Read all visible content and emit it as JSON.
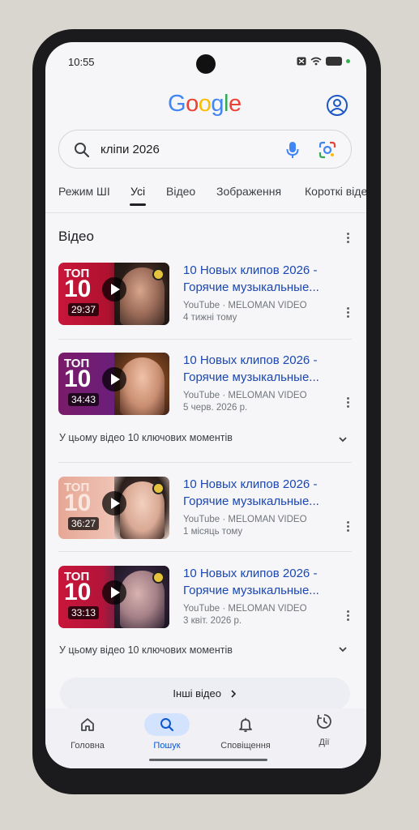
{
  "status": {
    "time": "10:55"
  },
  "header": {
    "logo": "Google",
    "account_icon": "account-circle-icon"
  },
  "search": {
    "query": "кліпи 2026"
  },
  "tabs": [
    {
      "label": "Режим ШІ"
    },
    {
      "label": "Усі",
      "active": true
    },
    {
      "label": "Відео"
    },
    {
      "label": "Зображення"
    },
    {
      "label": "Короткі відео"
    }
  ],
  "section": {
    "title": "Відео"
  },
  "videos": [
    {
      "title_line1": "10 Новых клипов 2026 -",
      "title_line2": "Горячие музыкальные...",
      "source": "YouTube · MELOMAN VIDEO",
      "date": "4 тижні тому",
      "duration": "29:37",
      "thumb_top": "ТОП",
      "thumb_num": "10"
    },
    {
      "title_line1": "10 Новых клипов 2026 -",
      "title_line2": "Горячие музыкальные...",
      "source": "YouTube · MELOMAN VIDEO",
      "date": "5 черв. 2026 р.",
      "duration": "34:43",
      "thumb_top": "ТОП",
      "thumb_num": "10"
    },
    {
      "title_line1": "10 Новых клипов 2026 -",
      "title_line2": "Горячие музыкальные...",
      "source": "YouTube · MELOMAN VIDEO",
      "date": "1 місяць тому",
      "duration": "36:27",
      "thumb_top": "ТОП",
      "thumb_num": "10"
    },
    {
      "title_line1": "10 Новых клипов 2026 -",
      "title_line2": "Горячие музыкальные...",
      "source": "YouTube · MELOMAN VIDEO",
      "date": "3 квіт. 2026 р.",
      "duration": "33:13",
      "thumb_top": "ТОП",
      "thumb_num": "10"
    }
  ],
  "key_moments": "У цьому відео 10 ключових моментів",
  "more_videos": "Інші відео",
  "bottom_nav": [
    {
      "label": "Головна",
      "icon": "home-icon"
    },
    {
      "label": "Пошук",
      "icon": "search-icon",
      "active": true
    },
    {
      "label": "Сповіщення",
      "icon": "bell-icon"
    },
    {
      "label": "Дії",
      "icon": "activity-icon"
    }
  ],
  "colors": {
    "link_blue": "#1a47b3",
    "accent": "#0b57d0",
    "background": "#f6f6f9"
  }
}
